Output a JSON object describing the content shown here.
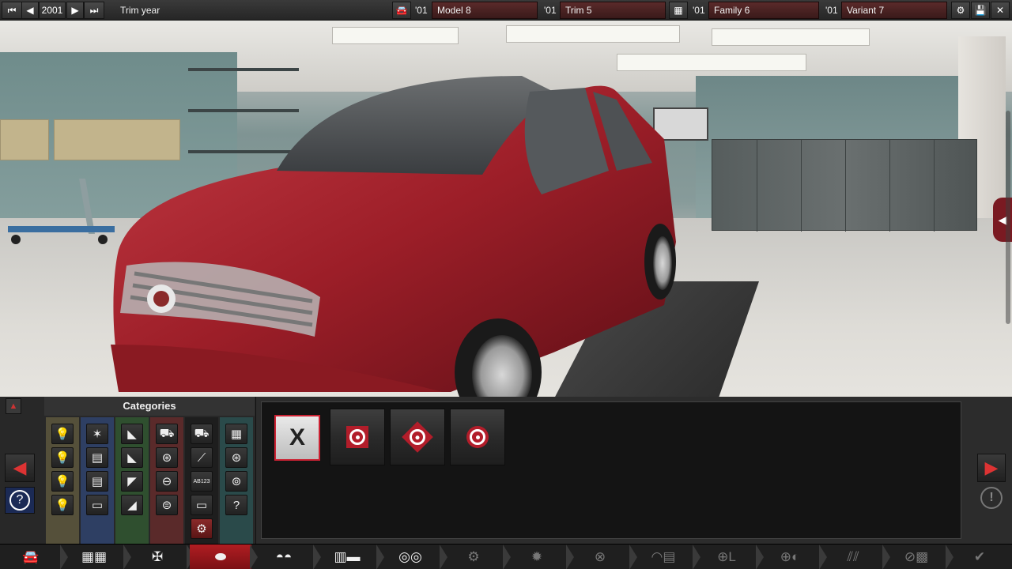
{
  "topbar": {
    "first_label": "⏮",
    "prev_label": "◀",
    "year": "2001",
    "next_label": "▶",
    "last_label": "⏭",
    "trim_year_label": "Trim year",
    "model_year": "'01",
    "model_name": "Model 8",
    "trim_year": "'01",
    "trim_name": "Trim 5",
    "family_year": "'01",
    "family_name": "Family 6",
    "variant_year": "'01",
    "variant_name": "Variant 7"
  },
  "categories": {
    "title": "Categories",
    "collapse_label": "▲",
    "prev_label": "◀",
    "help_label": "?",
    "columns": [
      {
        "color": "#55503a",
        "items": [
          "💡",
          "💡",
          "💡",
          "💡"
        ]
      },
      {
        "color": "#2e3f63",
        "items": [
          "✶",
          "▤",
          "▤",
          "▭"
        ]
      },
      {
        "color": "#2f4f2f",
        "items": [
          "◣",
          "◣",
          "◤",
          "◢"
        ]
      },
      {
        "color": "#5a2a2a",
        "items": [
          "⛟",
          "⊛",
          "⊖",
          "⊜"
        ]
      },
      {
        "color": "#1e1e1e",
        "items": [
          "⛟",
          "⟋",
          "AB123",
          "▭",
          "⚙"
        ]
      },
      {
        "color": "#2a4a4a",
        "items": [
          "▦",
          "⊛",
          "⊚",
          "?"
        ]
      }
    ]
  },
  "options": {
    "none_label": "X",
    "items": [
      "disc-style-1",
      "disc-style-2",
      "disc-style-3"
    ]
  },
  "side": {
    "next_label": "▶",
    "warning_label": "!",
    "tab_label": "◀"
  },
  "nav": {
    "items": [
      {
        "icon": "car",
        "label": "🚘"
      },
      {
        "icon": "chassis",
        "label": "▦▦"
      },
      {
        "icon": "suspension",
        "label": "✠"
      },
      {
        "icon": "body",
        "label": "⬬"
      },
      {
        "icon": "interior",
        "label": "◓◓"
      },
      {
        "icon": "fixtures",
        "label": "▥▬"
      },
      {
        "icon": "fittings",
        "label": "◎◎"
      },
      {
        "icon": "engine",
        "label": "⚙"
      },
      {
        "icon": "wheels",
        "label": "✹"
      },
      {
        "icon": "tyres",
        "label": "⊗"
      },
      {
        "icon": "aero",
        "label": "◠▤"
      },
      {
        "icon": "brakes",
        "label": "⊕L"
      },
      {
        "icon": "steering",
        "label": "⊕◐"
      },
      {
        "icon": "tuning",
        "label": "⫽⫽"
      },
      {
        "icon": "testing",
        "label": "⊘▩"
      },
      {
        "icon": "confirm",
        "label": "✔"
      }
    ]
  }
}
